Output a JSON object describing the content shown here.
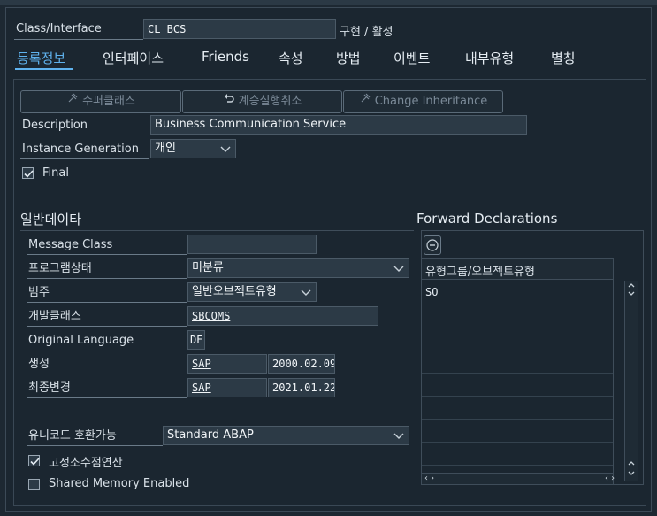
{
  "header": {
    "class_interface_label": "Class/Interface",
    "class_name": "CL_BCS",
    "status_text": "구현 / 활성"
  },
  "tabs": [
    {
      "label": "등록정보"
    },
    {
      "label": "인터페이스"
    },
    {
      "label": "Friends"
    },
    {
      "label": "속성"
    },
    {
      "label": "방법"
    },
    {
      "label": "이벤트"
    },
    {
      "label": "내부유형"
    },
    {
      "label": "별칭"
    }
  ],
  "toolbar": {
    "superclass_label": "수퍼클래스",
    "undo_inheritance_label": "계승실행취소",
    "change_inheritance_label": "Change Inheritance"
  },
  "properties": {
    "description_label": "Description",
    "description_value": "Business Communication Service",
    "instance_generation_label": "Instance Generation",
    "instance_generation_value": "개인",
    "final_label": "Final",
    "final_checked": true
  },
  "general_data": {
    "title": "일반데이타",
    "message_class_label": "Message Class",
    "message_class_value": "",
    "program_status_label": "프로그램상태",
    "program_status_value": "미분류",
    "category_label": "범주",
    "category_value": "일반오브젝트유형",
    "package_label": "개발클래스",
    "package_value": "SBCOMS",
    "original_language_label": "Original Language",
    "original_language_value": "DE",
    "created_label": "생성",
    "created_user": "SAP",
    "created_date": "2000.02.09",
    "last_changed_label": "최종변경",
    "changed_user": "SAP",
    "changed_date": "2021.01.22",
    "unicode_label": "유니코드 호환가능",
    "unicode_value": "Standard ABAP",
    "fixed_point_label": "고정소수점연산",
    "fixed_point_checked": true,
    "shared_memory_label": "Shared Memory Enabled",
    "shared_memory_checked": false
  },
  "forward_declarations": {
    "title": "Forward Declarations",
    "column_header": "유형그룹/오브젝트유형",
    "rows": [
      "SO"
    ]
  },
  "colors": {
    "background": "#1d2832",
    "accent": "#5fb2ee",
    "field_bg": "#2c3a46"
  }
}
